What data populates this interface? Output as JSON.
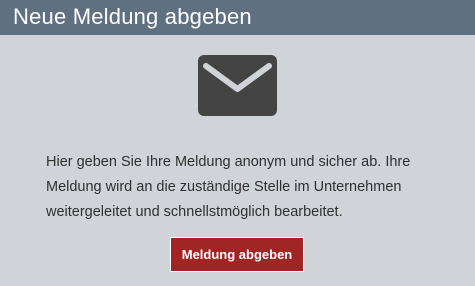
{
  "header": {
    "title": "Neue Meldung abgeben"
  },
  "icon": {
    "name": "envelope-icon",
    "color": "#444444"
  },
  "main": {
    "description": "Hier geben Sie Ihre Meldung anonym und sicher ab. Ihre Meldung wird an die zuständige Stelle im Unternehmen weitergeleitet und schnellstmöglich bearbeitet.",
    "button_label": "Meldung abgeben"
  },
  "colors": {
    "header_bg": "#5f7080",
    "panel_bg": "#d0d3d8",
    "button_bg": "#a12525",
    "text": "#303030"
  }
}
